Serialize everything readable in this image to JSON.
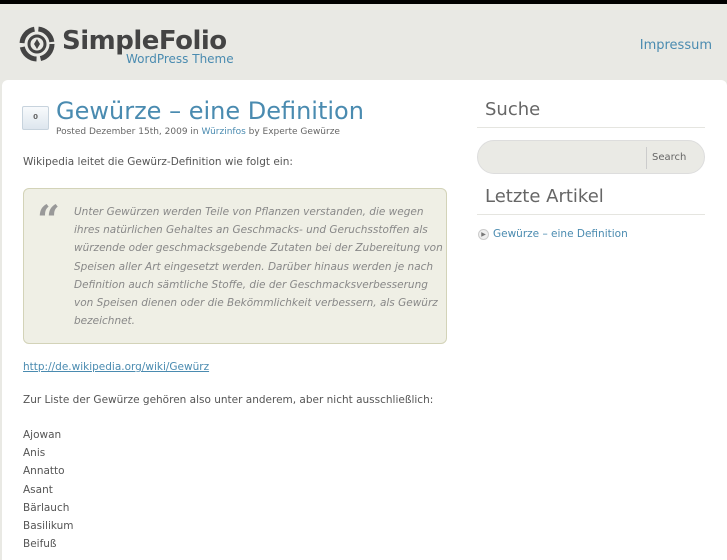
{
  "header": {
    "logo_title": "SimpleFolio",
    "logo_subtitle": "WordPress Theme",
    "nav": [
      "Impressum"
    ]
  },
  "post": {
    "comment_count": "0",
    "title": "Gewürze – eine Definition",
    "meta_prefix": "Posted Dezember 15th, 2009 in ",
    "category": "Würzinfos",
    "meta_suffix": " by Experte Gewürze",
    "intro": "Wikipedia leitet die Gewürz-Definition wie folgt ein:",
    "quote": "Unter Gewürzen werden Teile von Pflanzen verstanden, die wegen ihres natürlichen Gehaltes an Geschmacks- und Geruchsstoffen als würzende oder geschmacksgebende Zutaten bei der Zubereitung von Speisen aller Art eingesetzt werden. Darüber hinaus werden je nach Definition auch sämtliche Stoffe, die der Geschmacksverbesserung von Speisen dienen oder die Bekömmlichkeit verbessern, als Gewürz bezeichnet.",
    "link": "http://de.wikipedia.org/wiki/Gewürz",
    "list_intro": "Zur Liste der Gewürze gehören also unter anderem, aber nicht ausschließlich:",
    "items": [
      "Ajowan",
      "Anis",
      "Annatto",
      "Asant",
      "Bärlauch",
      "Basilikum",
      "Beifuß"
    ]
  },
  "sidebar": {
    "search_title": "Suche",
    "search_button": "Search",
    "search_value": "",
    "recent_title": "Letzte Artikel",
    "recent": [
      "Gewürze – eine Definition"
    ]
  }
}
